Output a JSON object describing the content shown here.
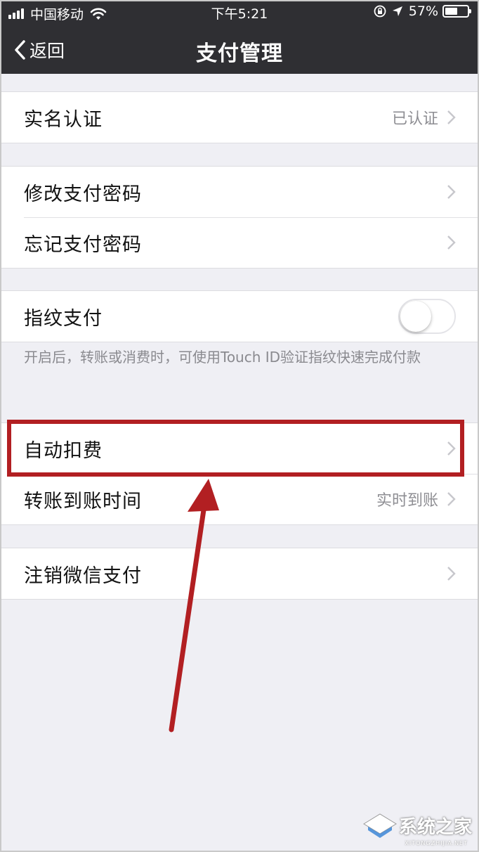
{
  "status_bar": {
    "carrier": "中国移动",
    "time": "下午5:21",
    "battery": "57%",
    "battery_level": 0.57
  },
  "nav": {
    "back_label": "返回",
    "title": "支付管理"
  },
  "sections": {
    "verify": {
      "label": "实名认证",
      "value": "已认证"
    },
    "password": [
      {
        "label": "修改支付密码"
      },
      {
        "label": "忘记支付密码"
      }
    ],
    "fingerprint": {
      "label": "指纹支付",
      "enabled": false,
      "hint": "开启后，转账或消费时，可使用Touch ID验证指纹快速完成付款"
    },
    "payments": [
      {
        "label": "自动扣费",
        "value": ""
      },
      {
        "label": "转账到账时间",
        "value": "实时到账"
      }
    ],
    "cancel": {
      "label": "注销微信支付"
    }
  },
  "annotation": {
    "color": "#b21f22"
  },
  "watermark": {
    "text": "系统之家",
    "sub": "XITONGZHIJIA.NET"
  },
  "colors": {
    "header": "#2f2f33",
    "background": "#efeff4",
    "chevron": "#c7c7cc"
  }
}
